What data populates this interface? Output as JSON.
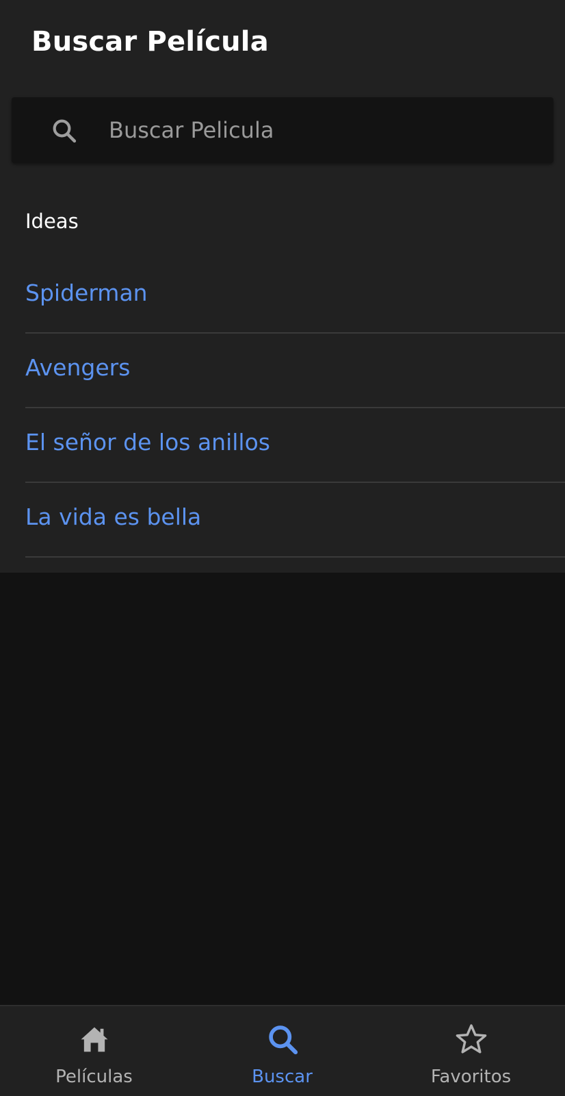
{
  "header": {
    "title": "Buscar Película"
  },
  "search": {
    "placeholder": "Buscar Pelicula",
    "value": "",
    "icon": "search-icon"
  },
  "ideas": {
    "heading": "Ideas",
    "items": [
      {
        "label": "Spiderman"
      },
      {
        "label": "Avengers"
      },
      {
        "label": "El señor de los anillos"
      },
      {
        "label": "La vida es bella"
      }
    ]
  },
  "bottom_nav": {
    "items": [
      {
        "label": "Películas",
        "icon": "home-icon",
        "active": false
      },
      {
        "label": "Buscar",
        "icon": "search-icon",
        "active": true
      },
      {
        "label": "Favoritos",
        "icon": "star-icon",
        "active": false
      }
    ]
  },
  "colors": {
    "accent": "#5c93f0",
    "surface": "#212121",
    "background": "#121212",
    "inactive": "#b3b3b3"
  }
}
